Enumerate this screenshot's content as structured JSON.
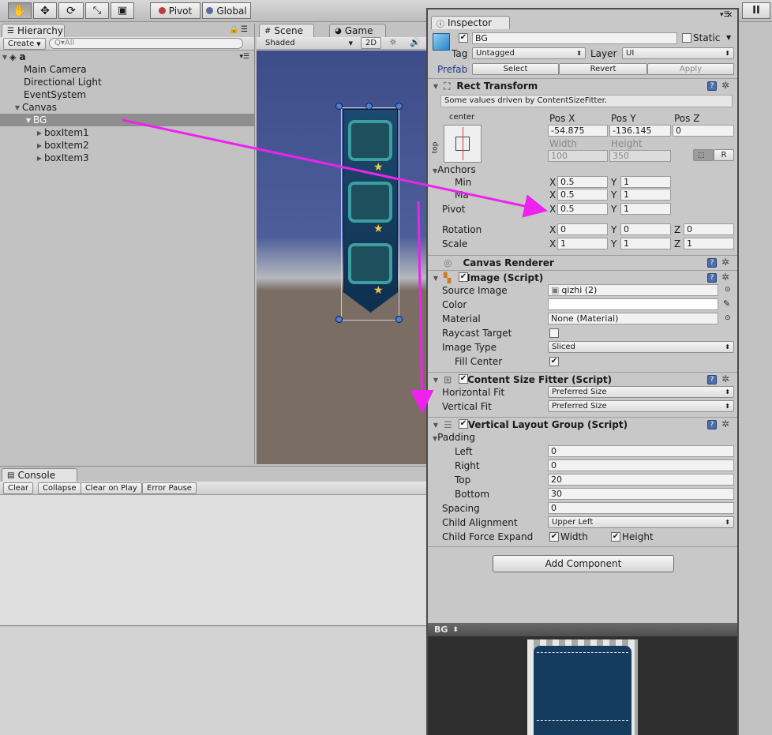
{
  "toolbar": {
    "tools": [
      "hand-tool",
      "move-tool",
      "rotate-tool",
      "scale-tool",
      "rect-tool"
    ],
    "pivot": "Pivot",
    "global": "Global",
    "pause_glyph": "II"
  },
  "hierarchy": {
    "tab": "Hierarchy",
    "create": "Create",
    "search_placeholder": "Q▾All",
    "scene_name": "a",
    "items": [
      "Main Camera",
      "Directional Light",
      "EventSystem",
      "Canvas",
      "BG",
      "boxItem1",
      "boxItem2",
      "boxItem3"
    ]
  },
  "scene": {
    "tab": "Scene",
    "game_tab": "Game",
    "shading": "Shaded",
    "mode2d": "2D"
  },
  "console": {
    "tab": "Console",
    "buttons": [
      "Clear",
      "Collapse",
      "Clear on Play",
      "Error Pause"
    ]
  },
  "inspector": {
    "tab": "Inspector",
    "object_name": "BG",
    "static": "Static",
    "tag_label": "Tag",
    "tag": "Untagged",
    "layer_label": "Layer",
    "layer": "UI",
    "prefab_label": "Prefab",
    "prefab_select": "Select",
    "prefab_revert": "Revert",
    "prefab_apply": "Apply",
    "rect": {
      "title": "Rect Transform",
      "note": "Some values driven by ContentSizeFitter.",
      "anchor_h": "center",
      "anchor_v": "top",
      "posx_label": "Pos X",
      "posy_label": "Pos Y",
      "posz_label": "Pos Z",
      "posx": "-54.875",
      "posy": "-136.145",
      "posz": "0",
      "width_label": "Width",
      "height_label": "Height",
      "width": "100",
      "height": "350",
      "r": "R",
      "anchors": "Anchors",
      "min": "Min",
      "max": "Ma",
      "pivot": "Pivot",
      "min_x": "0.5",
      "min_y": "1",
      "max_x": "0.5",
      "max_y": "1",
      "pivot_x": "0.5",
      "pivot_y": "1",
      "rotation": "Rotation",
      "rot_x": "0",
      "rot_y": "0",
      "rot_z": "0",
      "scale": "Scale",
      "scale_x": "1",
      "scale_y": "1",
      "scale_z": "1",
      "x": "X",
      "y": "Y",
      "z": "Z"
    },
    "canvas_renderer": "Canvas Renderer",
    "image": {
      "title": "Image (Script)",
      "source_label": "Source Image",
      "source": "qizhi (2)",
      "color_label": "Color",
      "material_label": "Material",
      "material": "None (Material)",
      "raycast_label": "Raycast Target",
      "type_label": "Image Type",
      "type": "Sliced",
      "fill_label": "Fill Center"
    },
    "csf": {
      "title": "Content Size Fitter (Script)",
      "h_label": "Horizontal Fit",
      "h": "Preferred Size",
      "v_label": "Vertical Fit",
      "v": "Preferred Size"
    },
    "vlg": {
      "title": "Vertical Layout Group (Script)",
      "padding": "Padding",
      "left_label": "Left",
      "left": "0",
      "right_label": "Right",
      "right": "0",
      "top_label": "Top",
      "top": "20",
      "bottom_label": "Bottom",
      "bottom": "30",
      "spacing_label": "Spacing",
      "spacing": "0",
      "align_label": "Child Alignment",
      "align": "Upper Left",
      "expand_label": "Child Force Expand",
      "expand_w": "Width",
      "expand_h": "Height"
    },
    "add_component": "Add Component",
    "preview": "BG"
  },
  "colors": {
    "arrow": "#ee22ee",
    "sky": "#4d5e9a",
    "ground": "#7a6d63",
    "banner": "#153c5e",
    "selection": "#8e8e8e"
  }
}
